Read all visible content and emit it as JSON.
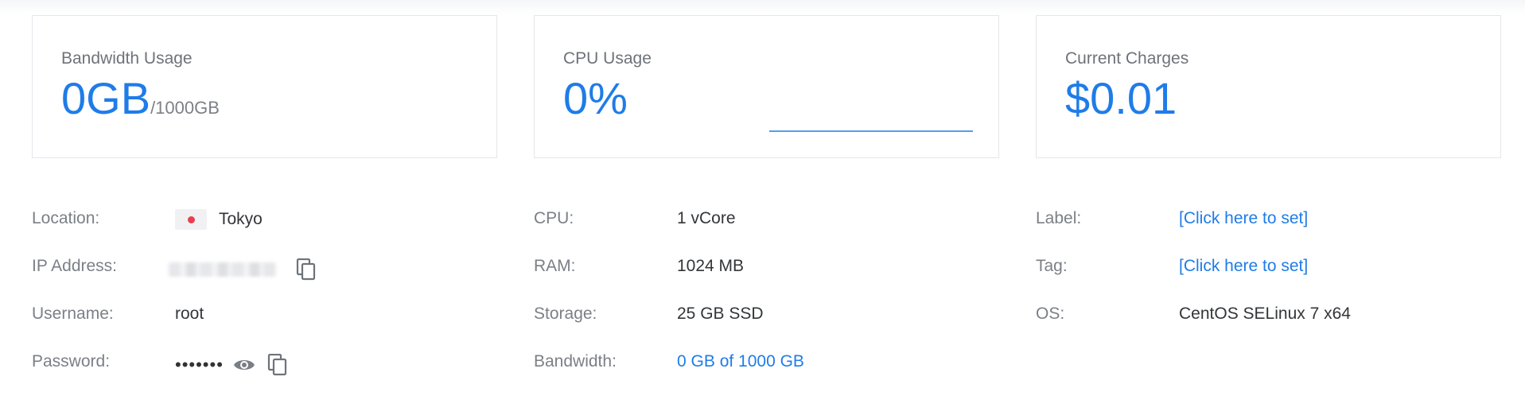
{
  "cards": {
    "bandwidth": {
      "label": "Bandwidth Usage",
      "value": "0GB",
      "unit": "/1000GB"
    },
    "cpu": {
      "label": "CPU Usage",
      "value": "0%"
    },
    "charges": {
      "label": "Current Charges",
      "value": "$0.01"
    }
  },
  "details": {
    "location": {
      "label": "Location:",
      "value": "Tokyo",
      "flag_icon": "japan-flag-icon"
    },
    "ip_address": {
      "label": "IP Address:",
      "copy_icon": "copy-icon"
    },
    "username": {
      "label": "Username:",
      "value": "root"
    },
    "password": {
      "label": "Password:",
      "value": "•••••••",
      "show_icon": "eye-icon",
      "copy_icon": "copy-icon"
    },
    "cpu": {
      "label": "CPU:",
      "value": "1 vCore"
    },
    "ram": {
      "label": "RAM:",
      "value": "1024 MB"
    },
    "storage": {
      "label": "Storage:",
      "value": "25 GB SSD"
    },
    "bandwidth": {
      "label": "Bandwidth:",
      "value": "0 GB of 1000 GB"
    },
    "label": {
      "label": "Label:",
      "value": "[Click here to set]"
    },
    "tag": {
      "label": "Tag:",
      "value": "[Click here to set]"
    },
    "os": {
      "label": "OS:",
      "value": "CentOS SELinux 7 x64"
    }
  },
  "colors": {
    "accent": "#1f7ce8",
    "label_text": "#7b8087",
    "card_border": "#e4e6ea",
    "flag_red": "#e8404f"
  }
}
